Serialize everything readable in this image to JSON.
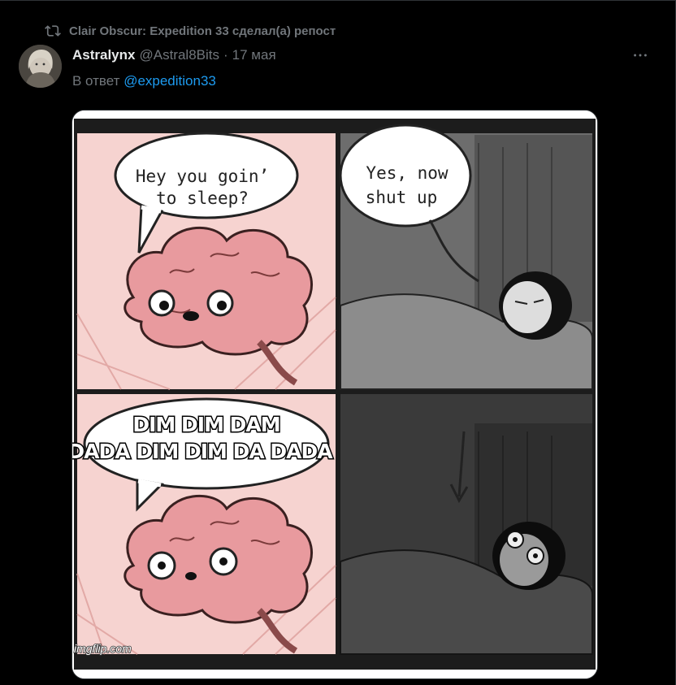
{
  "repost": {
    "text": "Clair Obscur: Expedition 33 сделал(а) репост",
    "icon": "repost-icon"
  },
  "author": {
    "display_name": "Astralynx",
    "handle": "@Astral8Bits",
    "separator": "·",
    "date": "17 мая"
  },
  "reply": {
    "prefix": "В ответ",
    "mention": "@expedition33"
  },
  "more_icon": "more-horizontal-icon",
  "meme": {
    "panel1_text_line1": "Hey you goin’",
    "panel1_text_line2": "to sleep?",
    "panel2_text_line1": "Yes, now",
    "panel2_text_line2": "shut up",
    "panel3_text_line1": "DIM DIM DAM",
    "panel3_text_line2": "DADA DIM DIM DA DADA",
    "watermark": "imgflip.com"
  },
  "colors": {
    "background": "#000000",
    "text_primary": "#e7e9ea",
    "text_secondary": "#71767b",
    "link": "#1d9bf0",
    "brain": "#e89a9e",
    "panel_pink": "#f6d3d0"
  }
}
